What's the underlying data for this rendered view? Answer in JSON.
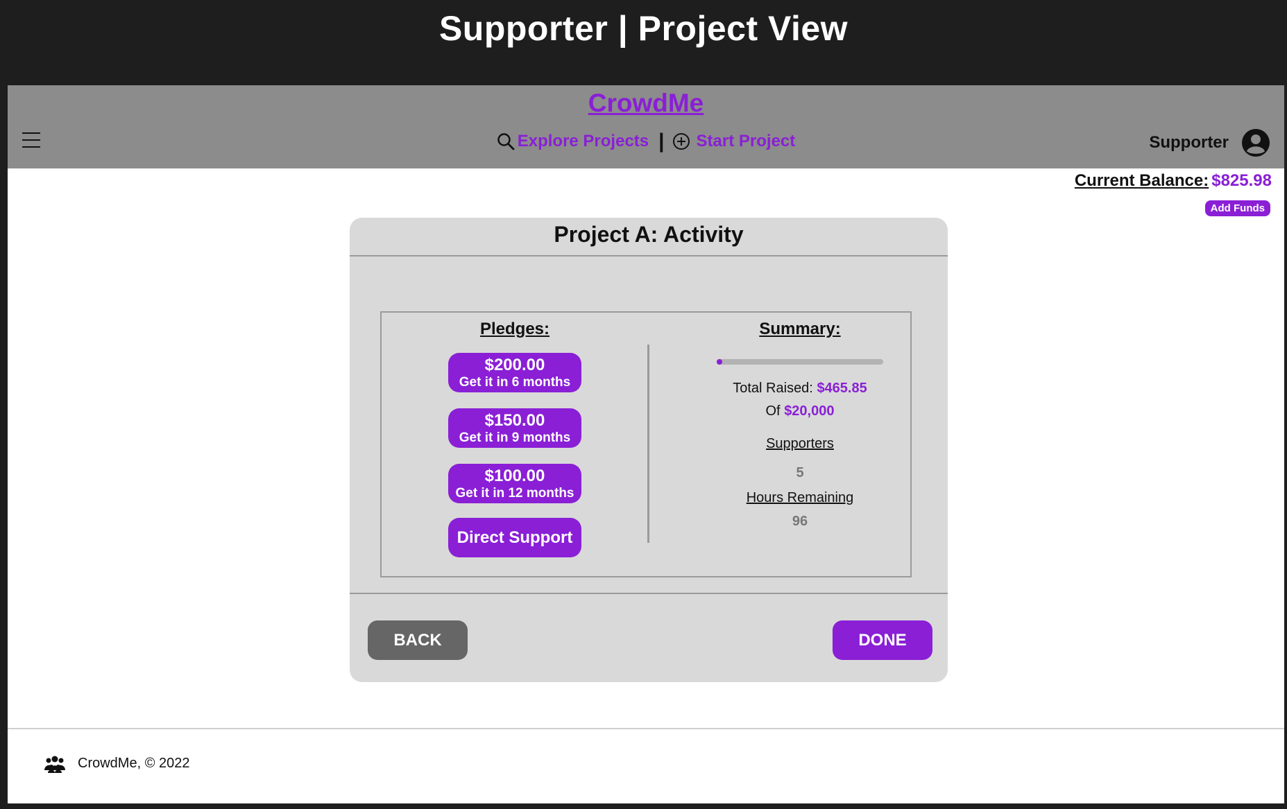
{
  "page": {
    "caption": "Supporter | Project View"
  },
  "header": {
    "brand": "CrowdMe",
    "nav": {
      "explore_label": "Explore Projects",
      "start_label": "Start Project",
      "explore_icon": "search-icon",
      "start_icon": "plus-circle-icon"
    },
    "user": {
      "label": "Supporter",
      "icon": "user-avatar-icon"
    },
    "menu_icon": "hamburger-icon"
  },
  "balance": {
    "label": "Current Balance:",
    "value": "$825.98",
    "add_funds_label": "Add Funds"
  },
  "project": {
    "title": "Project A: Activity",
    "pledges_title": "Pledges:",
    "pledges": [
      {
        "amount": "$200.00",
        "detail": "Get it in 6 months"
      },
      {
        "amount": "$150.00",
        "detail": "Get it in 9 months"
      },
      {
        "amount": "$100.00",
        "detail": "Get it in 12 months"
      }
    ],
    "direct_support_label": "Direct Support",
    "summary": {
      "title": "Summary:",
      "progress_fraction": 0.023,
      "total_raised_label": "Total Raised:",
      "total_raised_value": "$465.85",
      "of_label": "Of",
      "goal_value": "$20,000",
      "supporters_label": "Supporters",
      "supporters_value": "5",
      "hours_label": "Hours Remaining",
      "hours_value": "96"
    },
    "back_label": "BACK",
    "done_label": "DONE"
  },
  "footer": {
    "text": "CrowdMe, © 2022",
    "logo_icon": "people-group-icon"
  },
  "colors": {
    "accent": "#8a1fd6",
    "header_bg": "#8c8c8c",
    "card_bg": "#d9d9d9",
    "back_btn": "#666666"
  }
}
